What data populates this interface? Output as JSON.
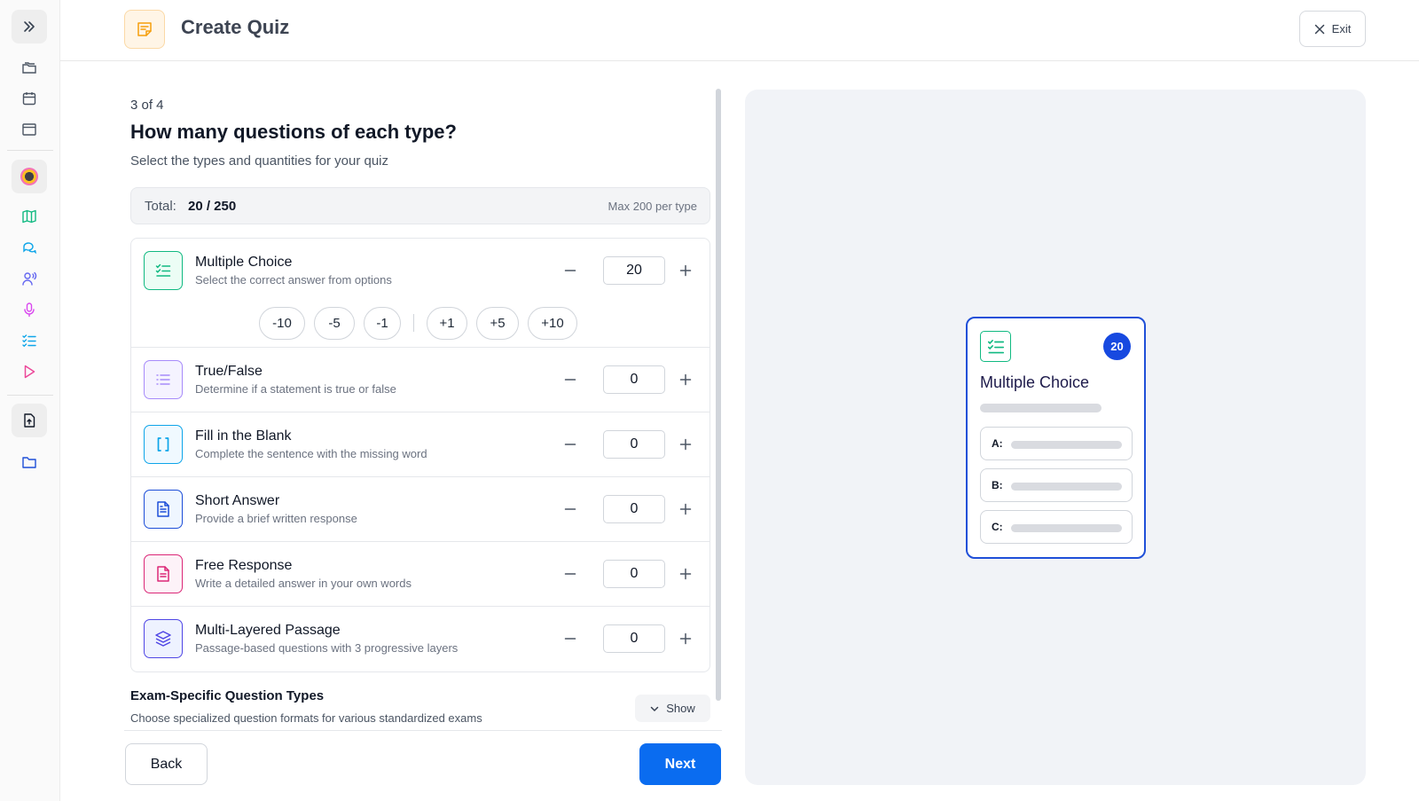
{
  "header": {
    "title": "Create Quiz",
    "exit_label": "Exit"
  },
  "sidebar": {
    "items": [
      {
        "icon": "chevrons-right-icon"
      },
      {
        "icon": "folders-icon"
      },
      {
        "icon": "calendar-icon"
      },
      {
        "icon": "window-icon"
      },
      {
        "icon": "avatar-icon"
      },
      {
        "icon": "map-icon"
      },
      {
        "icon": "chat-icon"
      },
      {
        "icon": "voice-user-icon"
      },
      {
        "icon": "microphone-icon"
      },
      {
        "icon": "checklist-icon"
      },
      {
        "icon": "play-icon"
      },
      {
        "icon": "file-upload-icon"
      },
      {
        "icon": "folder-icon"
      }
    ]
  },
  "form": {
    "step": "3 of 4",
    "title": "How many questions of each type?",
    "subtitle": "Select the types and quantities for your quiz",
    "total_label": "Total:",
    "total_value": "20 / 250",
    "max_label": "Max 200 per type",
    "quick_adjust": [
      "-10",
      "-5",
      "-1",
      "+1",
      "+5",
      "+10"
    ],
    "types": [
      {
        "name": "Multiple Choice",
        "desc": "Select the correct answer from options",
        "qty": "20",
        "icon": "checklist-icon",
        "color": "#10b981",
        "bg": "#ecfdf5"
      },
      {
        "name": "True/False",
        "desc": "Determine if a statement is true or false",
        "qty": "0",
        "icon": "list-icon",
        "color": "#a78bfa",
        "bg": "#f5f3ff"
      },
      {
        "name": "Fill in the Blank",
        "desc": "Complete the sentence with the missing word",
        "qty": "0",
        "icon": "brackets-icon",
        "color": "#0ea5e9",
        "bg": "#f0f9ff"
      },
      {
        "name": "Short Answer",
        "desc": "Provide a brief written response",
        "qty": "0",
        "icon": "document-icon",
        "color": "#1d4ed8",
        "bg": "#eff6ff"
      },
      {
        "name": "Free Response",
        "desc": "Write a detailed answer in your own words",
        "qty": "0",
        "icon": "document-pink-icon",
        "color": "#db2777",
        "bg": "#fdf2f8"
      },
      {
        "name": "Multi-Layered Passage",
        "desc": "Passage-based questions with 3 progressive layers",
        "qty": "0",
        "icon": "layers-icon",
        "color": "#4f46e5",
        "bg": "#eef2ff"
      }
    ],
    "exam_title": "Exam-Specific Question Types",
    "exam_subtitle": "Choose specialized question formats for various standardized exams",
    "show_label": "Show",
    "back_label": "Back",
    "next_label": "Next"
  },
  "preview": {
    "card_title": "Multiple Choice",
    "badge": "20",
    "options": [
      "A:",
      "B:",
      "C:"
    ]
  }
}
